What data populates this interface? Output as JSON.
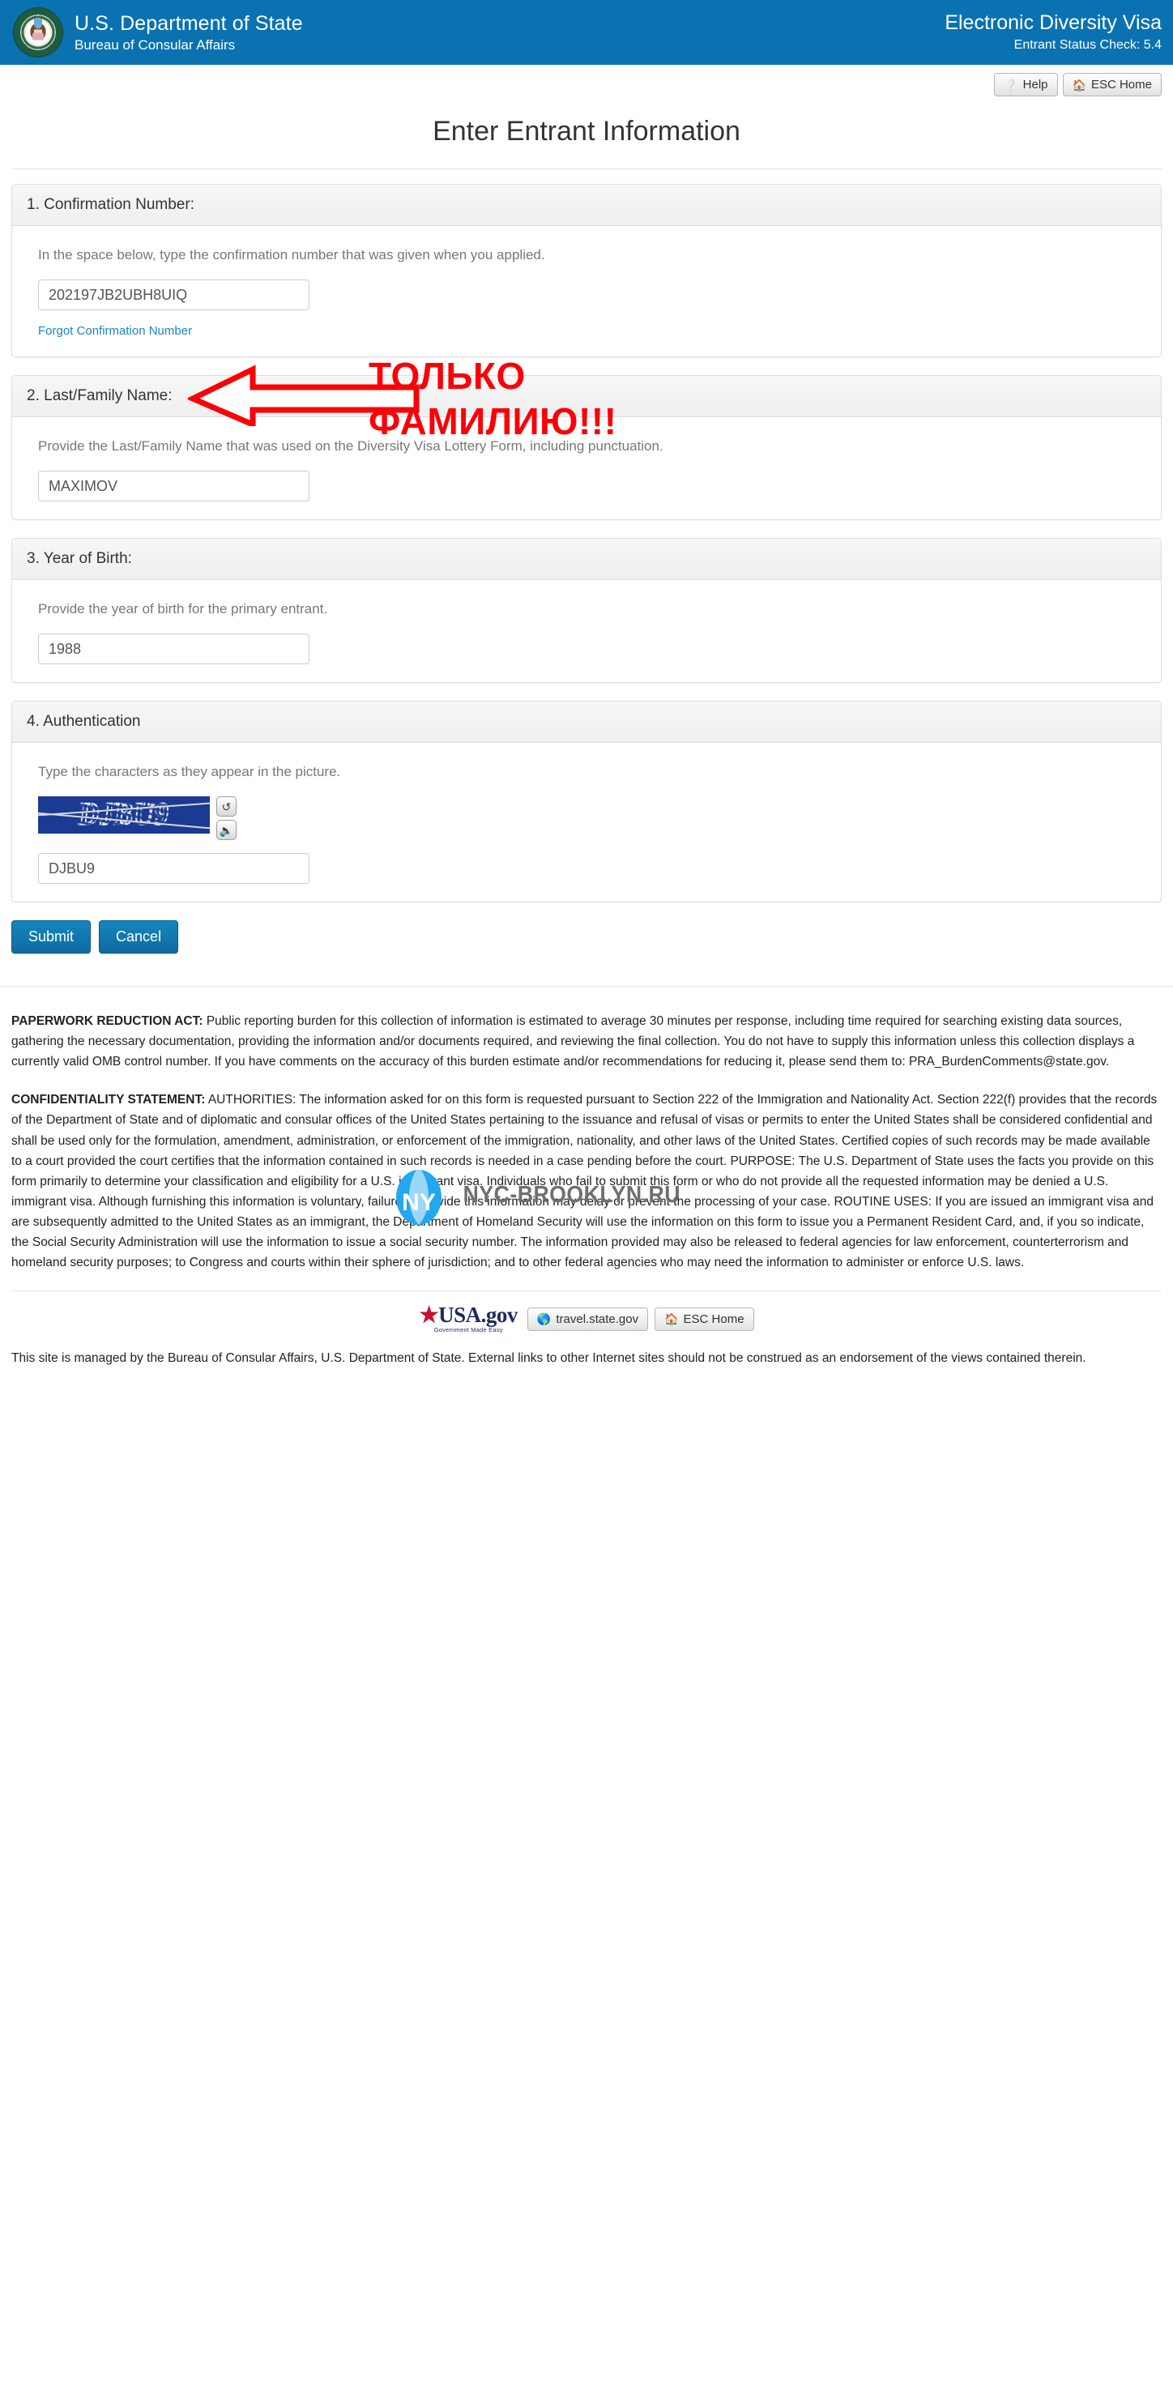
{
  "header": {
    "seal_icon": "dos-seal-icon",
    "dept_title": "U.S. Department of State",
    "bureau": "Bureau of Consular Affairs",
    "app_title": "Electronic Diversity Visa",
    "app_version": "Entrant Status Check: 5.4",
    "bg_color": "#0a72b0"
  },
  "toolbar": {
    "help_label": "Help",
    "help_icon": "question-circle-icon",
    "esc_home_label": "ESC Home",
    "home_icon": "home-icon"
  },
  "page": {
    "title": "Enter Entrant Information"
  },
  "sections": [
    {
      "heading": "1. Confirmation Number:",
      "note": "In the space below, type the confirmation number that was given when you applied.",
      "value": "202197JB2UBH8UIQ",
      "link": "Forgot Confirmation Number"
    },
    {
      "heading": "2. Last/Family Name:",
      "note": "Provide the Last/Family Name that was used on the Diversity Visa Lottery Form, including punctuation.",
      "value": "MAXIMOV"
    },
    {
      "heading": "3. Year of Birth:",
      "note": "Provide the year of birth for the primary entrant.",
      "value": "1988"
    },
    {
      "heading": "4. Authentication",
      "note": "Type the characters as they appear in the picture.",
      "captcha_image_text": "DJBU9",
      "captcha_bg": "#1a3a93",
      "refresh_icon": "refresh-icon",
      "audio_icon": "speaker-icon",
      "value": "DJBU9"
    }
  ],
  "actions": {
    "submit_label": "Submit",
    "cancel_label": "Cancel",
    "primary_color": "#1079ae"
  },
  "legal": {
    "paperwork_heading": "PAPERWORK REDUCTION ACT:",
    "paperwork_body": " Public reporting burden for this collection of information is estimated to average 30 minutes per response, including time required for searching existing data sources, gathering the necessary documentation, providing the information and/or documents required, and reviewing the final collection. You do not have to supply this information unless this collection displays a currently valid OMB control number. If you have comments on the accuracy of this burden estimate and/or recommendations for reducing it, please send them to: PRA_BurdenComments@state.gov.",
    "confidentiality_heading": "CONFIDENTIALITY STATEMENT:",
    "confidentiality_body": " AUTHORITIES: The information asked for on this form is requested pursuant to Section 222 of the Immigration and Nationality Act. Section 222(f) provides that the records of the Department of State and of diplomatic and consular offices of the United States pertaining to the issuance and refusal of visas or permits to enter the United States shall be considered confidential and shall be used only for the formulation, amendment, administration, or enforcement of the immigration, nationality, and other laws of the United States. Certified copies of such records may be made available to a court provided the court certifies that the information contained in such records is needed in a case pending before the court. PURPOSE: The U.S. Department of State uses the facts you provide on this form primarily to determine your classification and eligibility for a U.S. immigrant visa. Individuals who fail to submit this form or who do not provide all the requested information may be denied a U.S. immigrant visa. Although furnishing this information is voluntary, failure to provide this information may delay or prevent the processing of your case. ROUTINE USES: If you are issued an immigrant visa and are subsequently admitted to the United States as an immigrant, the Department of Homeland Security will use the information on this form to issue you a Permanent Resident Card, and, if you so indicate, the Social Security Administration will use the information to issue a social security number. The information provided may also be released to federal agencies for law enforcement, counterterrorism and homeland security purposes; to Congress and courts within their sphere of jurisdiction; and to other federal agencies who may need the information to administer or enforce U.S. laws."
  },
  "footer": {
    "usagov_main": "USA",
    "usagov_dotgov": ".gov",
    "usagov_tagline": "Government Made Easy",
    "travel_label": "travel.state.gov",
    "globe_icon": "globe-icon",
    "esc_home_label": "ESC Home",
    "home_icon": "home-icon",
    "note": "This site is managed by the Bureau of Consular Affairs, U.S. Department of State. External links to other Internet sites should not be construed as an endorsement of the views contained therein."
  },
  "annotation": {
    "line1": "ТОЛЬКО",
    "line2": "ФАМИЛИЮ!!!",
    "color": "#fb0007",
    "arrow_icon": "left-arrow-annotation-icon"
  },
  "watermark": {
    "logo_text": "NY",
    "site_text": "NYC-BROOKLYN.RU",
    "logo_color": "#22a7f0"
  }
}
